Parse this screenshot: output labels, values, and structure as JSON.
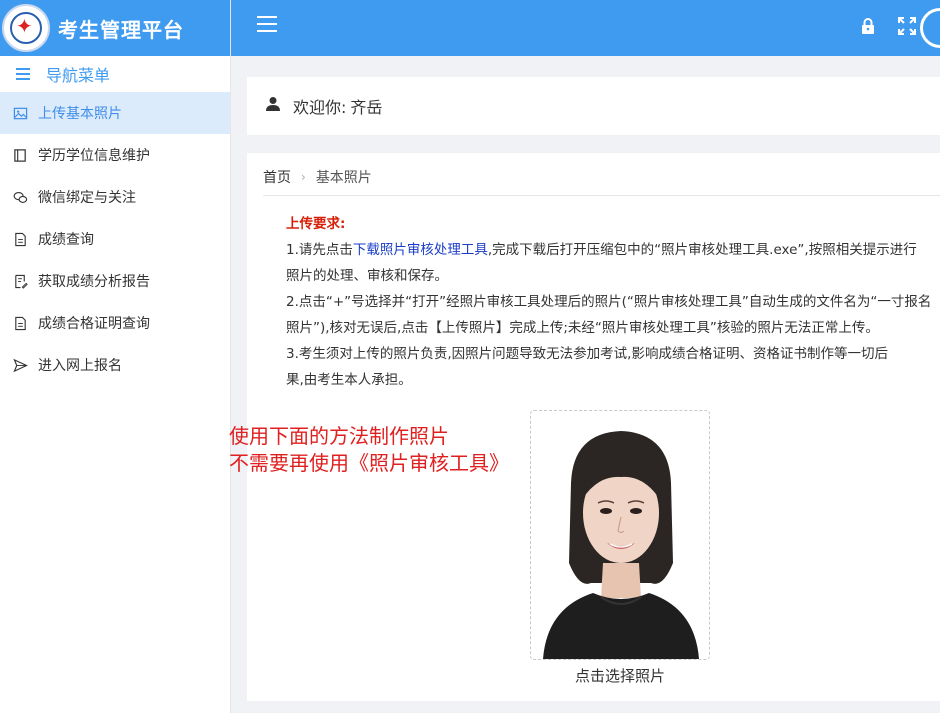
{
  "app": {
    "title": "考生管理平台"
  },
  "sidebar": {
    "header": "导航菜单",
    "items": [
      {
        "label": "上传基本照片",
        "icon": "image-icon",
        "active": true
      },
      {
        "label": "学历学位信息维护",
        "icon": "book-icon"
      },
      {
        "label": "微信绑定与关注",
        "icon": "wechat-icon"
      },
      {
        "label": "成绩查询",
        "icon": "document-icon"
      },
      {
        "label": "获取成绩分析报告",
        "icon": "report-icon"
      },
      {
        "label": "成绩合格证明查询",
        "icon": "certificate-icon"
      },
      {
        "label": "进入网上报名",
        "icon": "send-icon"
      }
    ]
  },
  "header": {
    "icons": [
      "lock-icon",
      "fullscreen-icon"
    ]
  },
  "welcome": {
    "label": "欢迎你:",
    "name": "齐岳"
  },
  "breadcrumb": {
    "home": "首页",
    "current": "基本照片"
  },
  "requirements": {
    "title": "上传要求:",
    "l1a": "1.请先点击",
    "l1_link": "下载照片审核处理工具",
    "l1b": ",完成下载后打开压缩包中的“照片审核处理工具.exe”,按照相关提示进行",
    "l2": "照片的处理、审核和保存。",
    "l3": "2.点击“+”号选择并“打开”经照片审核工具处理后的照片(“照片审核处理工具”自动生成的文件名为“一寸报名",
    "l4": "照片”),核对无误后,点击【上传照片】完成上传;未经“照片审核处理工具”核验的照片无法正常上传。",
    "l5": "3.考生须对上传的照片负责,因照片问题导致无法参加考试,影响成绩合格证明、资格证书制作等一切后",
    "l6": "果,由考生本人承担。"
  },
  "annotation": {
    "line1": "使用下面的方法制作照片",
    "line2": "不需要再使用《照片审核工具》"
  },
  "photo": {
    "caption": "点击选择照片"
  },
  "colors": {
    "primary": "#3f9bf0",
    "active_bg": "#dcebfb",
    "warning": "#d81e06",
    "annotation": "#e02020",
    "link": "#1a3cc8"
  }
}
